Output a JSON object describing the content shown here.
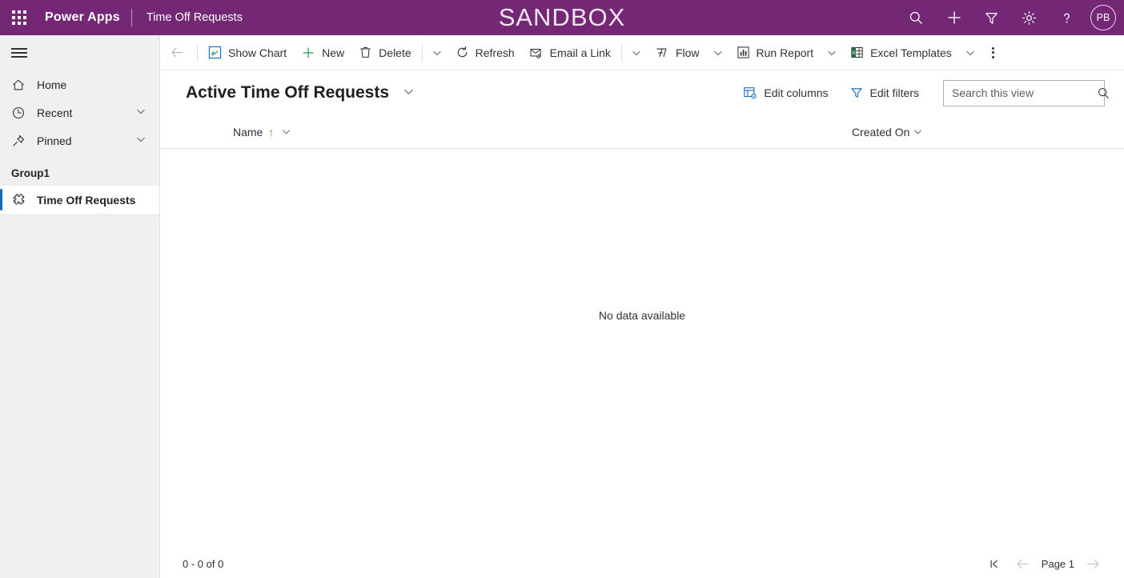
{
  "header": {
    "waffle_icon": "app-launcher-icon",
    "brand": "Power Apps",
    "app_name": "Time Off Requests",
    "environment_banner": "SANDBOX",
    "banner_color": "#742774",
    "icons": [
      {
        "name": "search-icon",
        "label": "Search"
      },
      {
        "name": "plus-icon",
        "label": "New"
      },
      {
        "name": "filter-icon",
        "label": "Filter"
      },
      {
        "name": "gear-icon",
        "label": "Settings"
      },
      {
        "name": "help-icon",
        "label": "Help"
      }
    ],
    "avatar_initials": "PB"
  },
  "sidebar": {
    "hamburger_icon": "hamburger-menu-icon",
    "items": [
      {
        "label": "Home",
        "icon": "home-icon",
        "has_chevron": false,
        "selected": false
      },
      {
        "label": "Recent",
        "icon": "clock-icon",
        "has_chevron": true,
        "selected": false
      },
      {
        "label": "Pinned",
        "icon": "pin-icon",
        "has_chevron": true,
        "selected": false
      }
    ],
    "group_label": "Group1",
    "group_items": [
      {
        "label": "Time Off Requests",
        "icon": "entity-icon",
        "selected": true
      }
    ],
    "selection_color": "#0f6cbd"
  },
  "command_bar": {
    "back_label": "Back",
    "buttons": [
      {
        "label": "Show Chart",
        "icon": "show-chart-icon"
      },
      {
        "label": "New",
        "icon": "plus-icon"
      },
      {
        "label": "Delete",
        "icon": "trash-icon"
      },
      {
        "label": "Refresh",
        "icon": "refresh-icon"
      },
      {
        "label": "Email a Link",
        "icon": "email-link-icon"
      },
      {
        "label": "Flow",
        "icon": "flow-icon"
      },
      {
        "label": "Run Report",
        "icon": "run-report-icon"
      },
      {
        "label": "Excel Templates",
        "icon": "excel-icon"
      }
    ],
    "overflow_label": "More commands"
  },
  "view_header": {
    "title": "Active Time Off Requests",
    "edit_columns_label": "Edit columns",
    "edit_filters_label": "Edit filters",
    "accent_color": "#0f6cbd"
  },
  "search": {
    "placeholder": "Search this view",
    "value": ""
  },
  "grid": {
    "columns": [
      {
        "label": "Name",
        "sorted": "asc",
        "sort_glyph": "↑"
      },
      {
        "label": "Created On",
        "sorted": "none"
      }
    ],
    "rows": [],
    "empty_message": "No data available"
  },
  "footer": {
    "record_count": "0 - 0 of 0",
    "page_label": "Page 1",
    "first_page_icon": "first-page-icon",
    "prev_page_icon": "previous-page-icon",
    "next_page_icon": "next-page-icon"
  }
}
